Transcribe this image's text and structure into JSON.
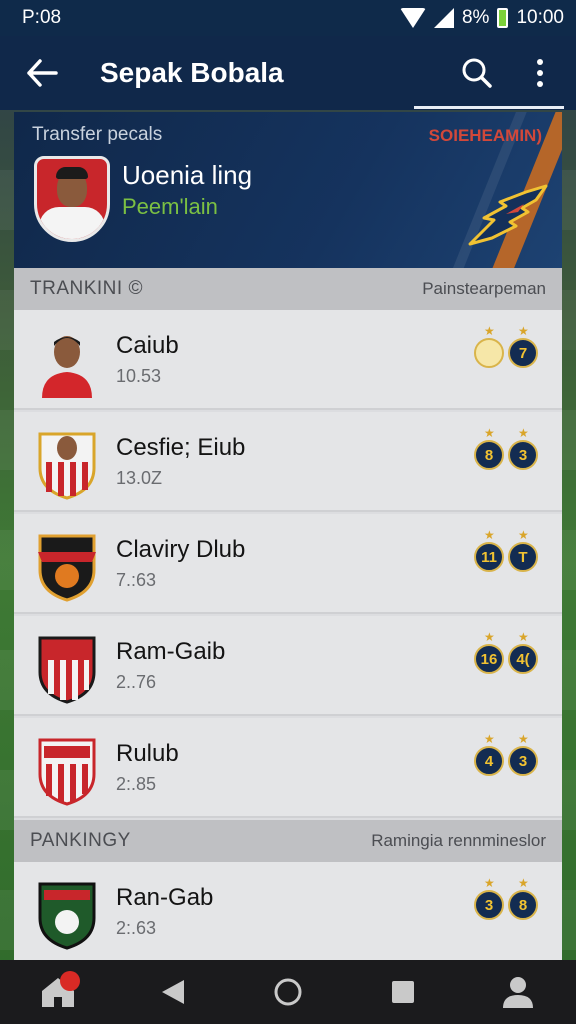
{
  "status_bar": {
    "left_text": "P:08",
    "battery_text": "8%",
    "time": "10:00"
  },
  "app_bar": {
    "title": "Sepak Bobala"
  },
  "hero": {
    "label": "Transfer pecals",
    "brand": "SOIEHEAMIN)",
    "name": "Uoenia ling",
    "subtitle": "Peem'lain"
  },
  "section1": {
    "title": "TRANKINI ©",
    "right": "Painstearpeman"
  },
  "rows1": [
    {
      "name": "Caiub",
      "value": "10.53",
      "badge1": "",
      "badge2": "7",
      "badge1_style": "gold"
    },
    {
      "name": "Cesfie; Eiub",
      "value": "13.0Z",
      "badge1": "8",
      "badge2": "3",
      "badge1_style": "dark"
    },
    {
      "name": "Claviry Dlub",
      "value": "7.:63",
      "badge1": "11",
      "badge2": "T",
      "badge1_style": "dark"
    },
    {
      "name": "Ram-Gaib",
      "value": "2..76",
      "badge1": "16",
      "badge2": "4(",
      "badge1_style": "dark"
    },
    {
      "name": "Rulub",
      "value": "2:.85",
      "badge1": "4",
      "badge2": "3",
      "badge1_style": "dark"
    }
  ],
  "section2": {
    "title": "PANKINGY",
    "right": "Ramingia rennmineslor"
  },
  "rows2": [
    {
      "name": "Ran-Gab",
      "value": "2:.63",
      "badge1": "3",
      "badge2": "8",
      "badge1_style": "dark"
    }
  ],
  "nav": {
    "home_badge": ""
  },
  "colors": {
    "primary": "#10284a",
    "accent": "#7bc043",
    "badge": "#132c52",
    "brand": "#d2483a"
  },
  "icons": [
    "back-arrow-icon",
    "search-icon",
    "more-vert-icon",
    "home-icon",
    "back-triangle-icon",
    "circle-home-icon",
    "square-recents-icon",
    "person-icon"
  ]
}
